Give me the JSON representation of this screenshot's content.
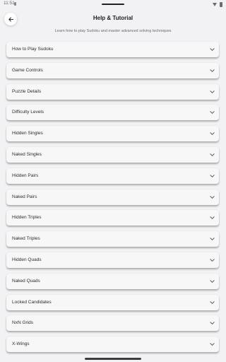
{
  "status": {
    "time": "11:51"
  },
  "header": {
    "title": "Help & Tutorial",
    "subtitle": "Learn how to play Sudoku and master advanced solving techniques",
    "back_icon": "arrow-left-icon"
  },
  "items": [
    {
      "label": "How to Play Sudoku"
    },
    {
      "label": "Game Controls"
    },
    {
      "label": "Puzzle Details"
    },
    {
      "label": "Difficulty Levels"
    },
    {
      "label": "Hidden Singles"
    },
    {
      "label": "Naked Singles"
    },
    {
      "label": "Hidden Pairs"
    },
    {
      "label": "Naked Pairs"
    },
    {
      "label": "Hidden Triples"
    },
    {
      "label": "Naked Triples"
    },
    {
      "label": "Hidden Quads"
    },
    {
      "label": "Naked Quads"
    },
    {
      "label": "Locked Candidates"
    },
    {
      "label": "NxN Grids"
    },
    {
      "label": "X-Wings"
    }
  ],
  "item_icon": "chevron-down-icon"
}
